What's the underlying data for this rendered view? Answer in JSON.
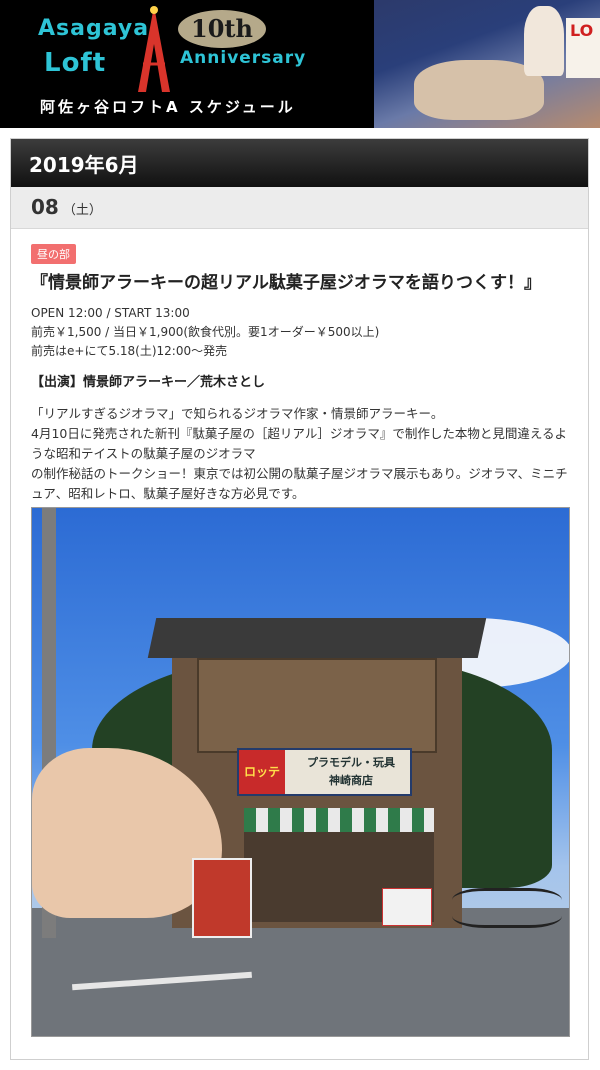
{
  "banner": {
    "logo_line1": "Asagaya",
    "logo_line2": "Loft",
    "anniversary_number": "10th",
    "anniversary_word": "Anniversary",
    "subtitle": "阿佐ヶ谷ロフトA スケジュール",
    "art_sign_text": "LO"
  },
  "schedule": {
    "month": "2019年6月",
    "date": {
      "day": "08",
      "weekday": "（土）"
    },
    "event": {
      "badge": "昼の部",
      "title": "『情景師アラーキーの超リアル駄菓子屋ジオラマを語りつくす！』",
      "open_start": "OPEN 12:00 / START 13:00",
      "price": "前売￥1,500 / 当日￥1,900(飲食代別。要1オーダー￥500以上)",
      "presale": "前売はe+にて5.18(土)12:00〜発売",
      "performers": "【出演】情景師アラーキー／荒木さとし",
      "description_1": "「リアルすぎるジオラマ」で知られるジオラマ作家・情景師アラーキー。",
      "description_2": "4月10日に発売された新刊『駄菓子屋の［超リアル］ジオラマ』で制作した本物と見間違えるような昭和テイストの駄菓子屋のジオラマ",
      "description_3": "の制作秘話のトークショー！東京では初公開の駄菓子屋ジオラマ展示もあり。ジオラマ、ミニチュア、昭和レトロ、駄菓子屋好きな方必見です。",
      "photo": {
        "sign_left": "ロッテ",
        "sign_right_line1": "プラモデル・玩具",
        "sign_right_line2": "神崎商店"
      }
    }
  },
  "colors": {
    "badge": "#f26f6f",
    "logo_cyan": "#2ec4d6",
    "header_dark": "#111111"
  }
}
